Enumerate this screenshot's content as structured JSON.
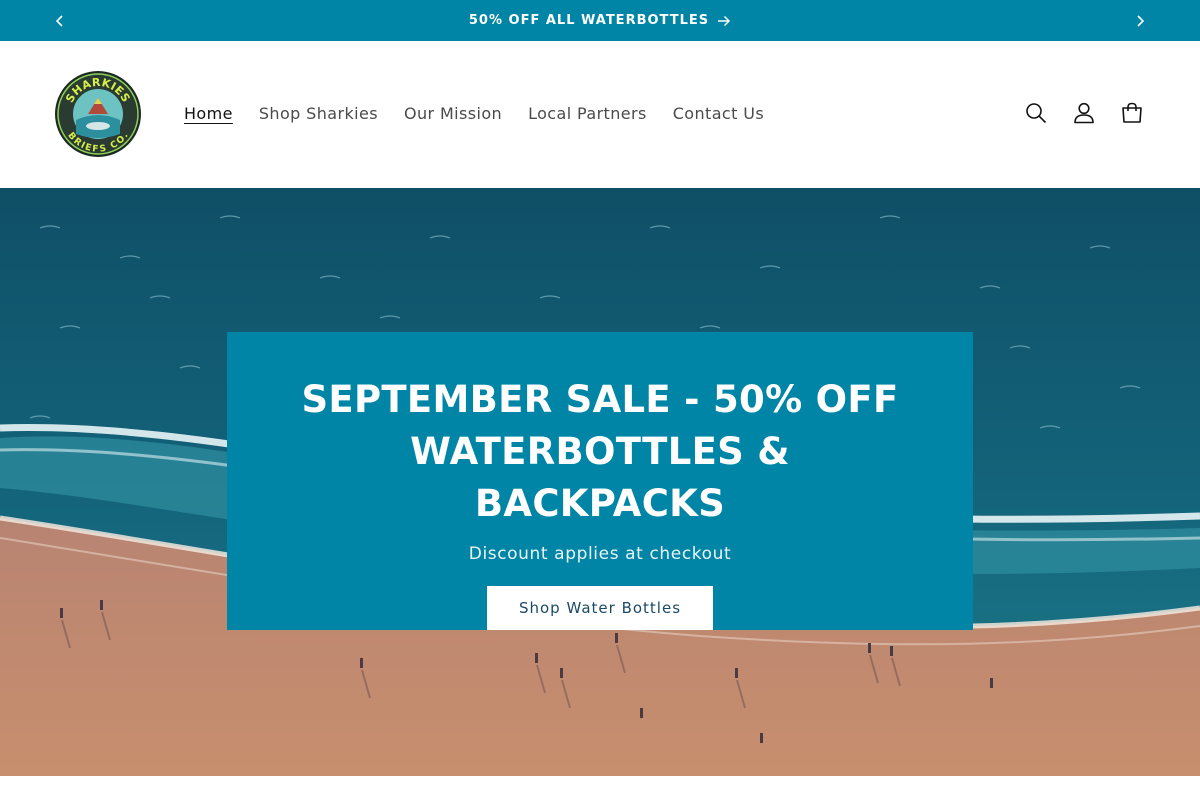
{
  "announcement": {
    "text": "50% OFF ALL WATERBOTTLES",
    "prev_icon": "chevron-left-icon",
    "next_icon": "chevron-right-icon",
    "arrow_icon": "arrow-right-icon",
    "bg_color": "#0085a6"
  },
  "header": {
    "logo": {
      "top_text": "SHARKIES",
      "bottom_text": "BRIEFS CO."
    },
    "nav": [
      {
        "label": "Home",
        "active": true
      },
      {
        "label": "Shop Sharkies",
        "active": false
      },
      {
        "label": "Our Mission",
        "active": false
      },
      {
        "label": "Local Partners",
        "active": false
      },
      {
        "label": "Contact Us",
        "active": false
      }
    ],
    "icons": [
      "search-icon",
      "account-icon",
      "cart-icon"
    ]
  },
  "hero": {
    "title": "SEPTEMBER SALE - 50% OFF WATERBOTTLES & BACKPACKS",
    "subtitle": "Discount applies at checkout",
    "button_label": "Shop Water Bottles",
    "box_color": "#0085a6"
  }
}
